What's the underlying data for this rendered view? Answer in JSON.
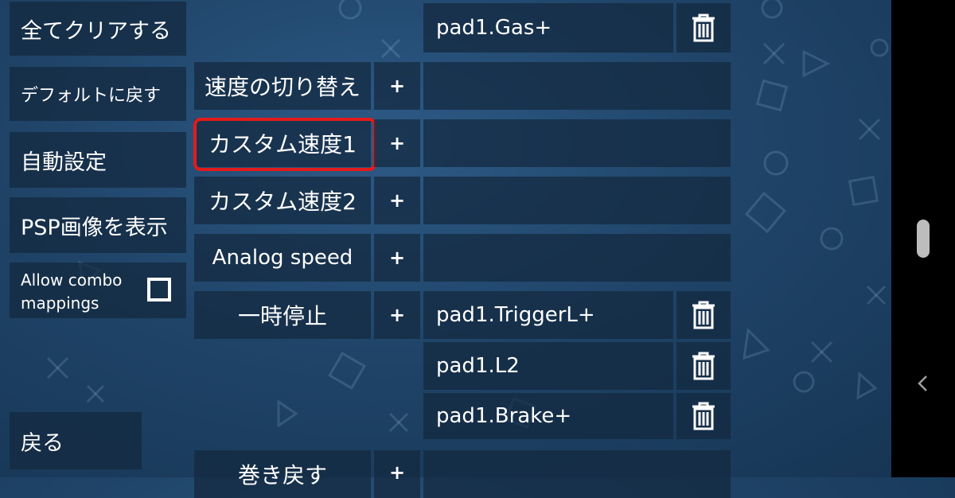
{
  "left_menu": {
    "clear_all": "全てクリアする",
    "reset_default": "デフォルトに戻す",
    "auto_configure": "自動設定",
    "show_psp_image": "PSP画像を表示",
    "allow_combo_line1": "Allow combo",
    "allow_combo_line2": "mappings",
    "allow_combo_checked": false,
    "back": "戻る"
  },
  "mappings": [
    {
      "name": "",
      "add": "",
      "mappings": [
        "pad1.Gas+"
      ]
    },
    {
      "name": "速度の切り替え",
      "add": "+",
      "mappings": [
        ""
      ]
    },
    {
      "name": "カスタム速度1",
      "add": "+",
      "mappings": [
        ""
      ],
      "highlighted": true
    },
    {
      "name": "カスタム速度2",
      "add": "+",
      "mappings": [
        ""
      ]
    },
    {
      "name": "Analog speed",
      "add": "+",
      "mappings": [
        ""
      ]
    },
    {
      "name": "一時停止",
      "add": "+",
      "mappings": [
        "pad1.TriggerL+",
        "pad1.L2",
        "pad1.Brake+"
      ]
    },
    {
      "name": "巻き戻す",
      "add": "+",
      "mappings": [
        ""
      ]
    }
  ],
  "icons": {
    "delete": "trash-icon",
    "checkbox": "checkbox-icon",
    "nav_back": "chevron-left-icon"
  },
  "colors": {
    "highlight": "#e31b1b",
    "background": "#1f4468",
    "button_bg": "#14283e",
    "nav_bar": "#000000"
  }
}
